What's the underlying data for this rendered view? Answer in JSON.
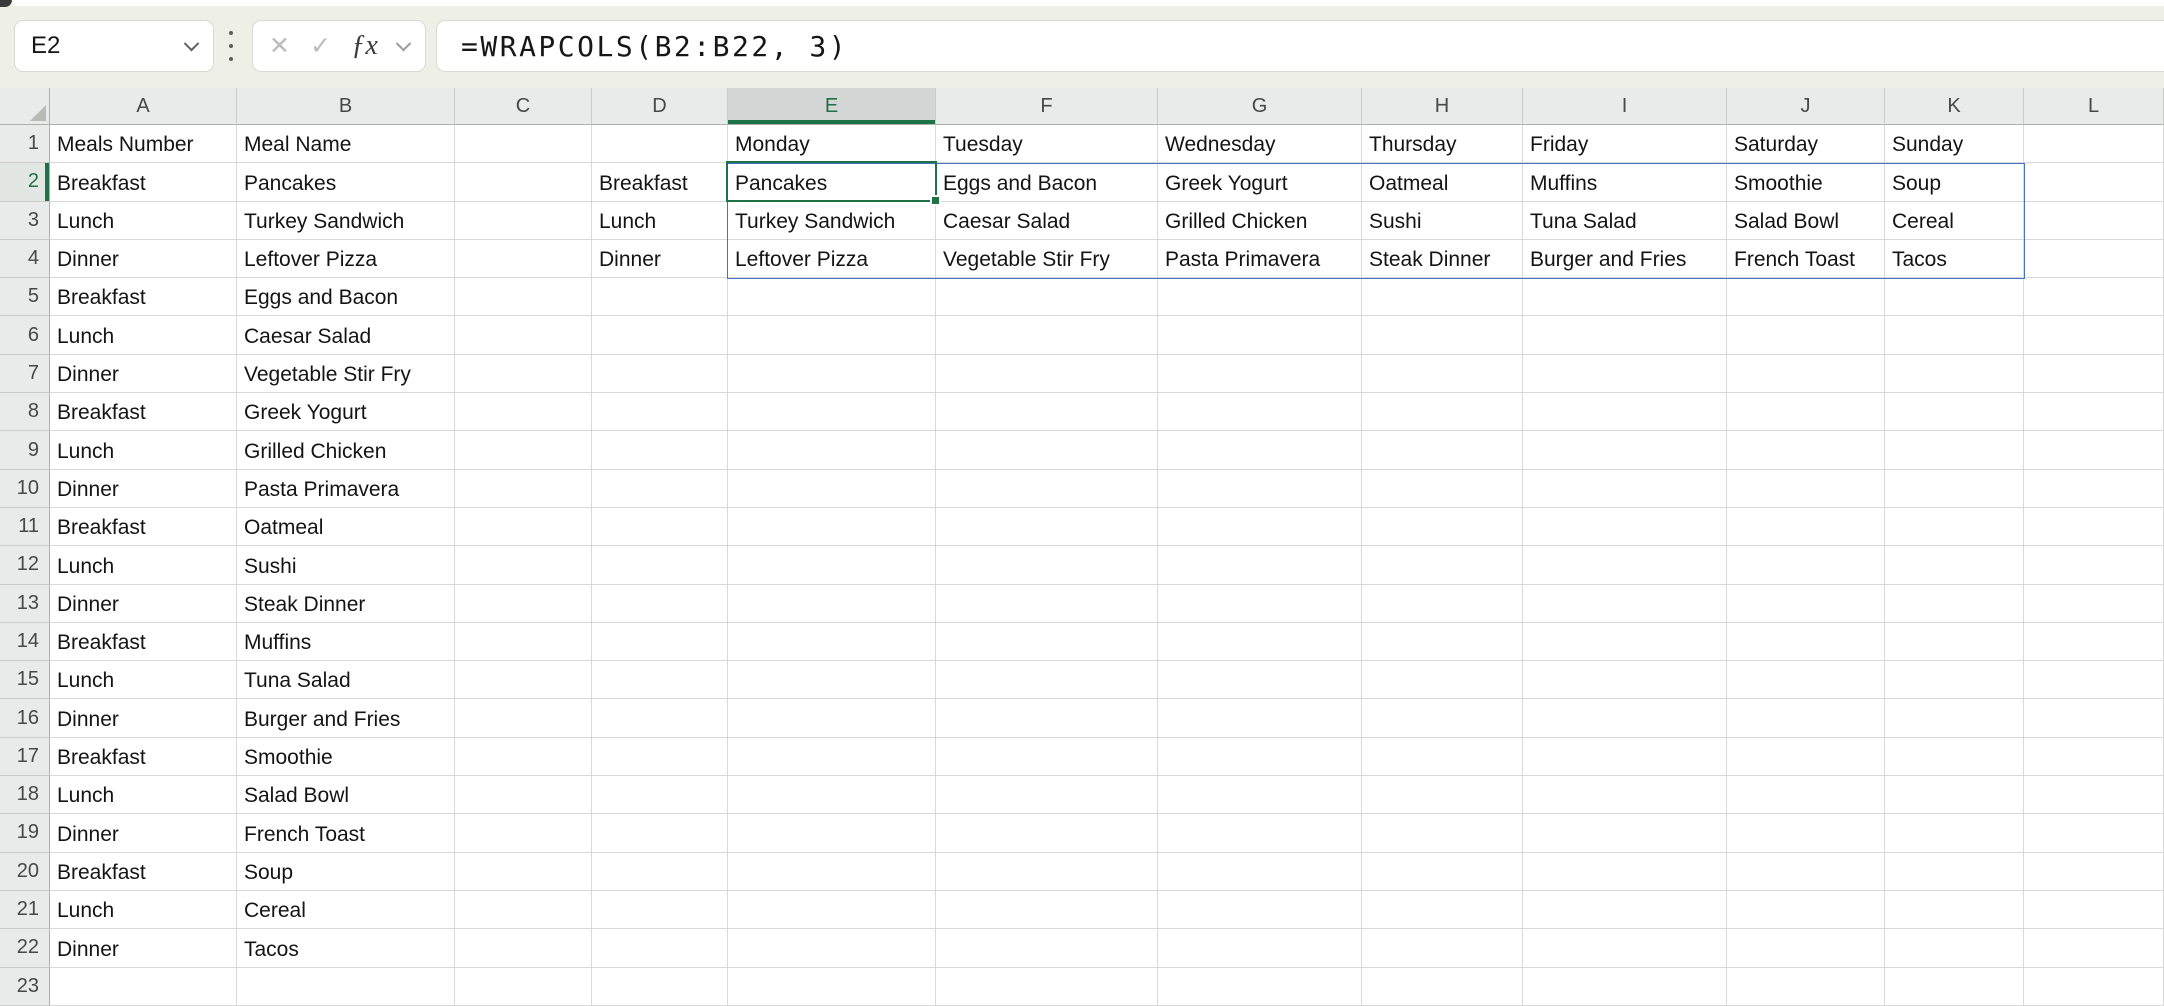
{
  "formula_bar": {
    "name_box_value": "E2",
    "cancel_icon": "✕",
    "enter_icon": "✓",
    "fx_label": "ƒx",
    "formula": "=WRAPCOLS(B2:B22, 3)"
  },
  "selection": {
    "active_cell": "E2",
    "selected_column": "E",
    "selected_row": 2,
    "spill_range": "E2:K4",
    "accent_green": "#1F7245",
    "spill_blue": "#4472C4"
  },
  "grid": {
    "column_headers": [
      "A",
      "B",
      "C",
      "D",
      "E",
      "F",
      "G",
      "H",
      "I",
      "J",
      "K",
      "L"
    ],
    "rows": [
      {
        "r": 1,
        "cells": {
          "A": "Meals Number",
          "B": "Meal Name",
          "E": "Monday",
          "F": "Tuesday",
          "G": "Wednesday",
          "H": "Thursday",
          "I": "Friday",
          "J": "Saturday",
          "K": "Sunday"
        }
      },
      {
        "r": 2,
        "cells": {
          "A": "Breakfast",
          "B": "Pancakes",
          "D": "Breakfast",
          "E": "Pancakes",
          "F": "Eggs and Bacon",
          "G": "Greek Yogurt",
          "H": "Oatmeal",
          "I": "Muffins",
          "J": "Smoothie",
          "K": "Soup"
        }
      },
      {
        "r": 3,
        "cells": {
          "A": "Lunch",
          "B": "Turkey Sandwich",
          "D": "Lunch",
          "E": "Turkey Sandwich",
          "F": "Caesar Salad",
          "G": "Grilled Chicken",
          "H": "Sushi",
          "I": "Tuna Salad",
          "J": "Salad Bowl",
          "K": "Cereal"
        }
      },
      {
        "r": 4,
        "cells": {
          "A": "Dinner",
          "B": "Leftover Pizza",
          "D": "Dinner",
          "E": "Leftover Pizza",
          "F": "Vegetable Stir Fry",
          "G": "Pasta Primavera",
          "H": "Steak Dinner",
          "I": "Burger and Fries",
          "J": "French Toast",
          "K": "Tacos"
        }
      },
      {
        "r": 5,
        "cells": {
          "A": "Breakfast",
          "B": "Eggs and Bacon"
        }
      },
      {
        "r": 6,
        "cells": {
          "A": "Lunch",
          "B": "Caesar Salad"
        }
      },
      {
        "r": 7,
        "cells": {
          "A": "Dinner",
          "B": "Vegetable Stir Fry"
        }
      },
      {
        "r": 8,
        "cells": {
          "A": "Breakfast",
          "B": "Greek Yogurt"
        }
      },
      {
        "r": 9,
        "cells": {
          "A": "Lunch",
          "B": "Grilled Chicken"
        }
      },
      {
        "r": 10,
        "cells": {
          "A": "Dinner",
          "B": "Pasta Primavera"
        }
      },
      {
        "r": 11,
        "cells": {
          "A": "Breakfast",
          "B": "Oatmeal"
        }
      },
      {
        "r": 12,
        "cells": {
          "A": "Lunch",
          "B": "Sushi"
        }
      },
      {
        "r": 13,
        "cells": {
          "A": "Dinner",
          "B": "Steak Dinner"
        }
      },
      {
        "r": 14,
        "cells": {
          "A": "Breakfast",
          "B": "Muffins"
        }
      },
      {
        "r": 15,
        "cells": {
          "A": "Lunch",
          "B": "Tuna Salad"
        }
      },
      {
        "r": 16,
        "cells": {
          "A": "Dinner",
          "B": "Burger and Fries"
        }
      },
      {
        "r": 17,
        "cells": {
          "A": "Breakfast",
          "B": "Smoothie"
        }
      },
      {
        "r": 18,
        "cells": {
          "A": "Lunch",
          "B": "Salad Bowl"
        }
      },
      {
        "r": 19,
        "cells": {
          "A": "Dinner",
          "B": "French Toast"
        }
      },
      {
        "r": 20,
        "cells": {
          "A": "Breakfast",
          "B": "Soup"
        }
      },
      {
        "r": 21,
        "cells": {
          "A": "Lunch",
          "B": "Cereal"
        }
      },
      {
        "r": 22,
        "cells": {
          "A": "Dinner",
          "B": "Tacos"
        }
      },
      {
        "r": 23,
        "cells": {}
      }
    ]
  }
}
